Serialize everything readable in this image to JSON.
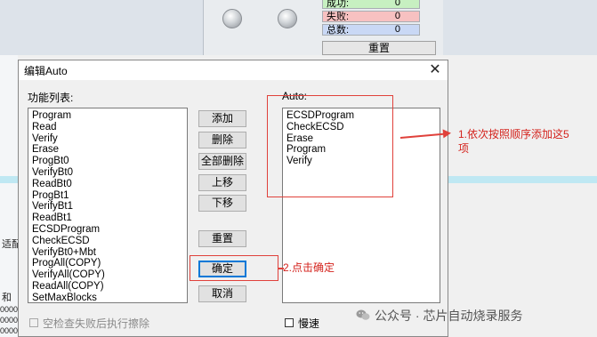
{
  "background": {
    "stats": [
      {
        "label": "成功:",
        "value": "0",
        "color": "#c7f0c1"
      },
      {
        "label": "失败:",
        "value": "0",
        "color": "#f7c1c1"
      },
      {
        "label": "总数:",
        "value": "0",
        "color": "#c9d8f5"
      }
    ],
    "reset_label": "重置",
    "fragments": {
      "frag1": "适配",
      "frag2": "和",
      "frag3": "0000",
      "frag4": "0000",
      "frag5": "0000"
    }
  },
  "dialog": {
    "title": "编辑Auto",
    "close_glyph": "✕",
    "function_list_label": "功能列表:",
    "function_list": [
      "Program",
      "Read",
      "Verify",
      "Erase",
      "ProgBt0",
      "VerifyBt0",
      "ReadBt0",
      "ProgBt1",
      "VerifyBt1",
      "ReadBt1",
      "ECSDProgram",
      "CheckECSD",
      "VerifyBt0+Mbt",
      "ProgAll(COPY)",
      "VerifyAll(COPY)",
      "ReadAll(COPY)",
      "SetMaxBlocks"
    ],
    "buttons": {
      "add": "添加",
      "delete": "删除",
      "delete_all": "全部删除",
      "move_up": "上移",
      "move_down": "下移",
      "reset": "重置",
      "ok": "确定",
      "cancel": "取消"
    },
    "auto_label": "Auto:",
    "auto_list": [
      "ECSDProgram",
      "CheckECSD",
      "Erase",
      "Program",
      "Verify"
    ],
    "checkbox_retry_label": "空检查失败后执行擦除",
    "checkbox_slow_label": "慢速"
  },
  "annotations": {
    "note1_line1": "1.依次按照顺序添加这5",
    "note1_line2": "项",
    "note2": "2.点击确定",
    "accent_color": "#e0413b"
  },
  "watermark": {
    "icon": "wechat-icon",
    "text": "公众号 · 芯片自动烧录服务"
  }
}
